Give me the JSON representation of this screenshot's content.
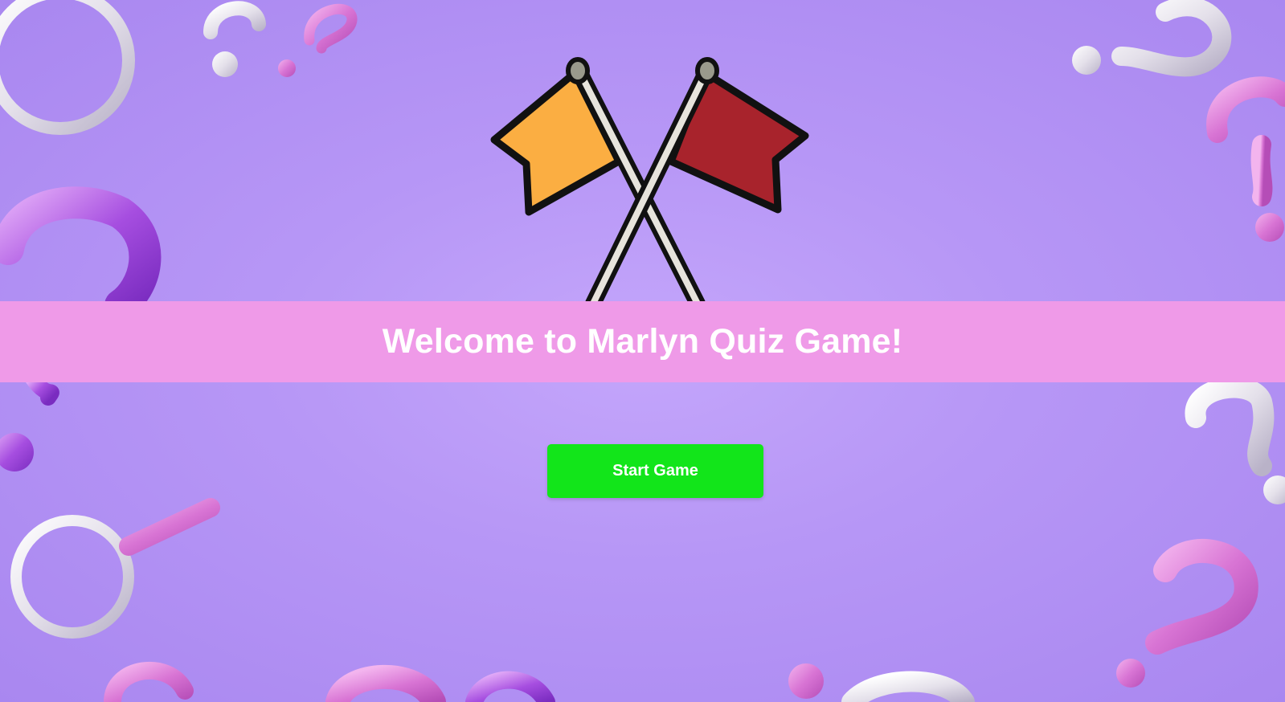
{
  "page": {
    "title": "Welcome to Marlyn Quiz Game!"
  },
  "actions": {
    "start_label": "Start Game"
  },
  "graphics": {
    "logo_icon": "crossed-flags-icon",
    "background_icons": [
      "question-mark-icon",
      "magnifying-glass-icon",
      "ring-icon"
    ]
  },
  "colors": {
    "background": "#b797f6",
    "banner": "#ef9ae8",
    "button": "#12e51a",
    "flag_left": "#fbae42",
    "flag_right": "#a8232c"
  }
}
